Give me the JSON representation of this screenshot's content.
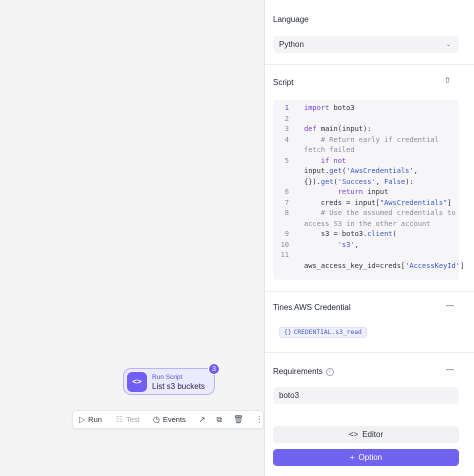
{
  "node": {
    "kind": "Run Script",
    "title": "List s3 buckets",
    "icon": "code-brackets-icon",
    "badge": "3",
    "accent": "#6f5ff2"
  },
  "toolbar": {
    "run": "Run",
    "test": "Test",
    "events": "Events"
  },
  "panel": {
    "language_label": "Language",
    "language_value": "Python",
    "script_label": "Script",
    "code_lines": [
      {
        "n": "1"
      },
      {
        "n": "2"
      },
      {
        "n": "3"
      },
      {
        "n": "4"
      },
      {
        "n": "5"
      },
      {
        "n": "6"
      },
      {
        "n": "7"
      },
      {
        "n": "8"
      },
      {
        "n": "9"
      },
      {
        "n": "10"
      },
      {
        "n": "11"
      }
    ],
    "code": {
      "l1_kw": "import",
      "l1_rest": " boto3",
      "l3_kw": "def",
      "l3_rest": " main(input):",
      "l4a": "# Return early if credential",
      "l4b": "fetch failed",
      "l5_kw": "if not",
      "l5b_pre": "input.",
      "l5b_get": "get",
      "l5b_str": "'AwsCredentials'",
      "l5b_end": ",",
      "l5c_pre": "{}).",
      "l5c_get": "get",
      "l5c_str": "'Success'",
      "l5c_mid": ", ",
      "l5c_false": "False",
      "l5c_end": "):",
      "l6_kw": "return",
      "l6_rest": " input",
      "l7_pre": "creds = input[",
      "l7_str": "\"AwsCredentials\"",
      "l7_end": "]",
      "l8a": "# Use the assumed credentials to",
      "l8b": "access S3 in the other account",
      "l9_pre": "s3 = boto3.",
      "l9_fn": "client",
      "l9_end": "(",
      "l10_str": "'s3'",
      "l10_end": ",",
      "l11_pre": "aws_access_key_id=creds[",
      "l11_str": "'AccessKeyId'",
      "l11_end": "]"
    },
    "credential_label": "Tines AWS Credential",
    "credential_value": "CREDENTIAL.s3_read",
    "requirements_label": "Requirements",
    "requirements_value": "boto3",
    "editor_button": "Editor",
    "option_button": "Option"
  }
}
